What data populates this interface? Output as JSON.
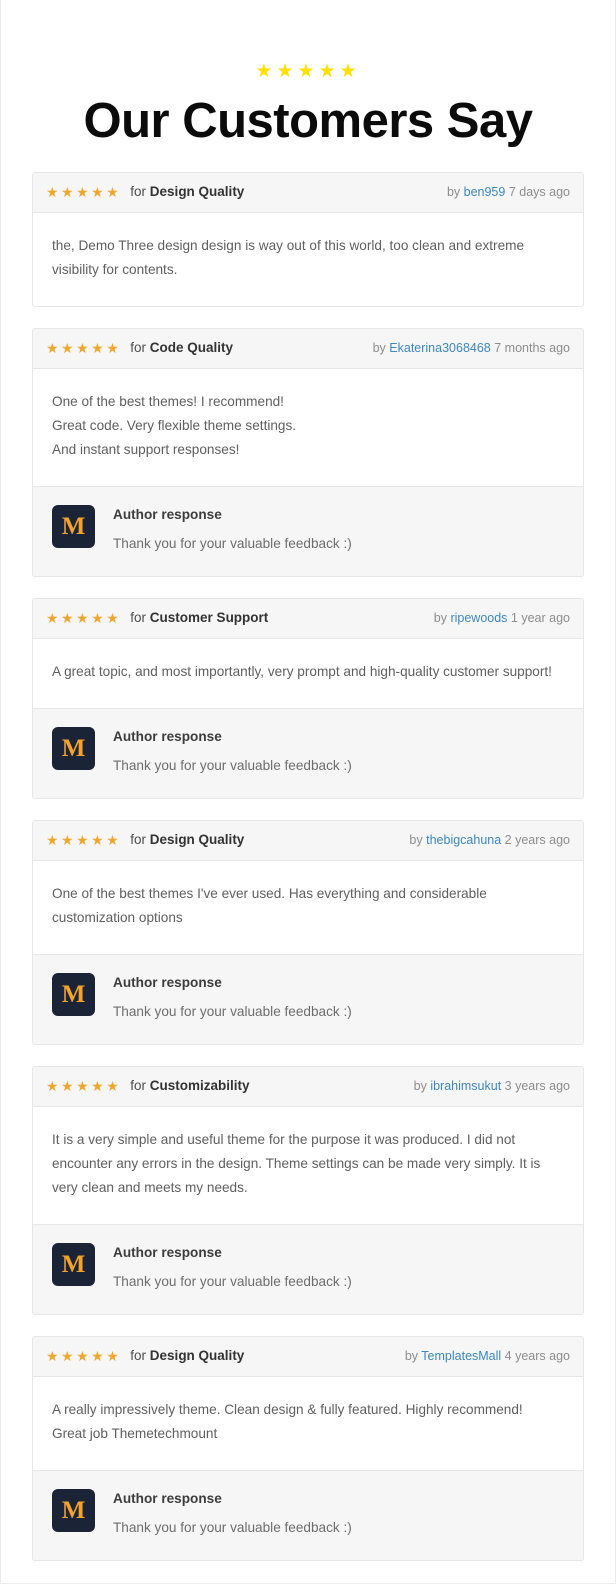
{
  "header": {
    "stars": "★★★★★",
    "star_count": 5,
    "title": "Our Customers Say",
    "star_color": "#ffe100",
    "title_color": "#0b0b0b"
  },
  "theme": {
    "card_star_color": "#efa72f",
    "link_color": "#3d87bd",
    "card_header_bg": "#f6f6f6",
    "card_border": "#e7e7e8",
    "avatar_bg": "#1b2436",
    "avatar_fg": "#f5a22a",
    "body_text_color": "#5f5f5f"
  },
  "labels": {
    "for": "for",
    "by": "by",
    "author_response": "Author response",
    "stars": "★★★★★"
  },
  "reviews": [
    {
      "stars": "★★★★★",
      "rating": 5,
      "criteria": "Design Quality",
      "username": "ben959",
      "time_ago": "7 days ago",
      "body": "the, Demo Three design design is way out of this world, too clean and extreme visibility for contents.",
      "response": null
    },
    {
      "stars": "★★★★★",
      "rating": 5,
      "criteria": "Code Quality",
      "username": "Ekaterina3068468",
      "time_ago": "7 months ago",
      "body": "One of the best themes! I recommend!\nGreat code. Very flexible theme settings.\nAnd instant support responses!",
      "response": {
        "avatar_letter": "M",
        "title": "Author response",
        "message": "Thank you for your valuable feedback :)"
      }
    },
    {
      "stars": "★★★★★",
      "rating": 5,
      "criteria": "Customer Support",
      "username": "ripewoods",
      "time_ago": "1 year ago",
      "body": "A great topic, and most importantly, very prompt and high-quality customer support!",
      "response": {
        "avatar_letter": "M",
        "title": "Author response",
        "message": "Thank you for your valuable feedback :)"
      }
    },
    {
      "stars": "★★★★★",
      "rating": 5,
      "criteria": "Design Quality",
      "username": "thebigcahuna",
      "time_ago": "2 years ago",
      "body": "One of the best themes I've ever used. Has everything and considerable customization options",
      "response": {
        "avatar_letter": "M",
        "title": "Author response",
        "message": "Thank you for your valuable feedback :)"
      }
    },
    {
      "stars": "★★★★★",
      "rating": 5,
      "criteria": "Customizability",
      "username": "ibrahimsukut",
      "time_ago": "3 years ago",
      "body": "It is a very simple and useful theme for the purpose it was produced. I did not encounter any errors in the design. Theme settings can be made very simply. It is very clean and meets my needs.",
      "response": {
        "avatar_letter": "M",
        "title": "Author response",
        "message": "Thank you for your valuable feedback :)"
      }
    },
    {
      "stars": "★★★★★",
      "rating": 5,
      "criteria": "Design Quality",
      "username": "TemplatesMall",
      "time_ago": "4 years ago",
      "body": "A really impressively theme. Clean design & fully featured. Highly recommend!\nGreat job Themetechmount",
      "response": {
        "avatar_letter": "M",
        "title": "Author response",
        "message": "Thank you for your valuable feedback :)"
      }
    }
  ]
}
